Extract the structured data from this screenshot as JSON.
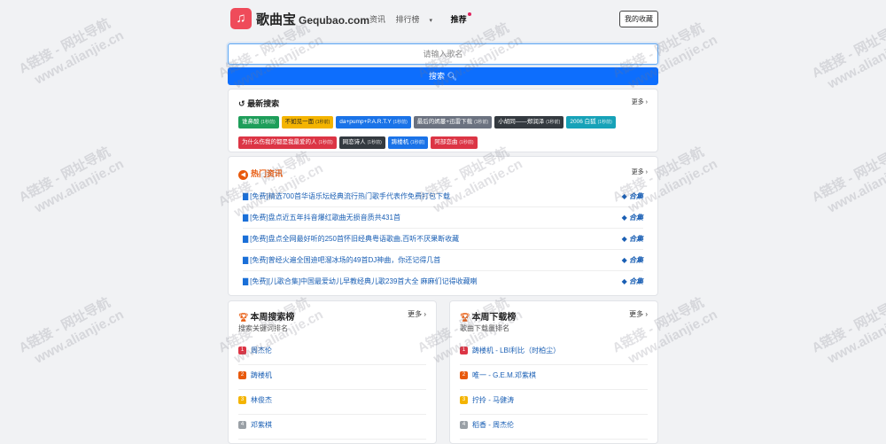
{
  "header": {
    "site_name": "歌曲宝",
    "domain": "Gequbao.com",
    "nav": [
      "资讯",
      "排行榜",
      "推荐"
    ],
    "fav_button": "我的收藏"
  },
  "search": {
    "placeholder": "请输入歌名",
    "button": "搜索"
  },
  "recent": {
    "title": "最新搜索",
    "more": "更多",
    "tags": [
      {
        "label": "谁鼻酸",
        "time": "(1秒前)",
        "color": "#1e9e5a"
      },
      {
        "label": "不如见一面",
        "time": "(1秒前)",
        "color": "#f4b400"
      },
      {
        "label": "da+pump+P.A.R.T.Y",
        "time": "(1秒前)",
        "color": "#1a73e8"
      },
      {
        "label": "最后的嫣蔓+迅雷下载",
        "time": "(1秒前)",
        "color": "#6b7280"
      },
      {
        "label": "小胡同——郑润泽",
        "time": "(1秒前)",
        "color": "#343a40"
      },
      {
        "label": "2006 白狐",
        "time": "(1秒前)",
        "color": "#17a2b8"
      },
      {
        "label": "为什么伤我的都是我最爱的人",
        "time": "(1秒前)",
        "color": "#dc3545"
      },
      {
        "label": "网恋诗人",
        "time": "(1秒前)",
        "color": "#343a40"
      },
      {
        "label": "踌楼机",
        "time": "(1秒前)",
        "color": "#1a73e8"
      },
      {
        "label": "阿部恋曲",
        "time": "(1秒前)",
        "color": "#dc3545"
      }
    ]
  },
  "news": {
    "title": "热门资讯",
    "more": "更多",
    "items": [
      {
        "text": "[免费]精选700首华语乐坛经典流行热门歌手代表作免费打包下载",
        "tag": "合集"
      },
      {
        "text": "[免费]盘点近五年抖音爆红歌曲无损音质共431首",
        "tag": "合集"
      },
      {
        "text": "[免费]盘点全网最好听的250首怀旧经典粤语歌曲,百听不厌果断收藏",
        "tag": "合集"
      },
      {
        "text": "[免费]曾经火遍全国迪吧溜冰场的49首DJ神曲，你还记得几首",
        "tag": "合集"
      },
      {
        "text": "[免费][儿歌合集]中国最爱幼儿早教经典儿歌239首大全 麻麻们记得收藏喇",
        "tag": "合集"
      }
    ]
  },
  "rank_search": {
    "title": "本周搜索榜",
    "subtitle": "搜索关键词排名",
    "more": "更多",
    "items": [
      "周杰伦",
      "踌楼机",
      "林俊杰",
      "邓紫棋"
    ]
  },
  "rank_download": {
    "title": "本周下载榜",
    "subtitle": "歌曲下载量排名",
    "more": "更多",
    "items": [
      "踌楼机 - LBI利比（时柏尘）",
      "唯一 - G.E.M.邓紫棋",
      "拧拎 - 马健涛",
      "稻香 - 周杰伦"
    ]
  },
  "rank_colors": [
    "#dc3545",
    "#e8590c",
    "#f4b400",
    "#9aa0a6"
  ],
  "watermark": {
    "line1": "A链接 - 网址导航",
    "line2": "www.alianjie.cn"
  }
}
